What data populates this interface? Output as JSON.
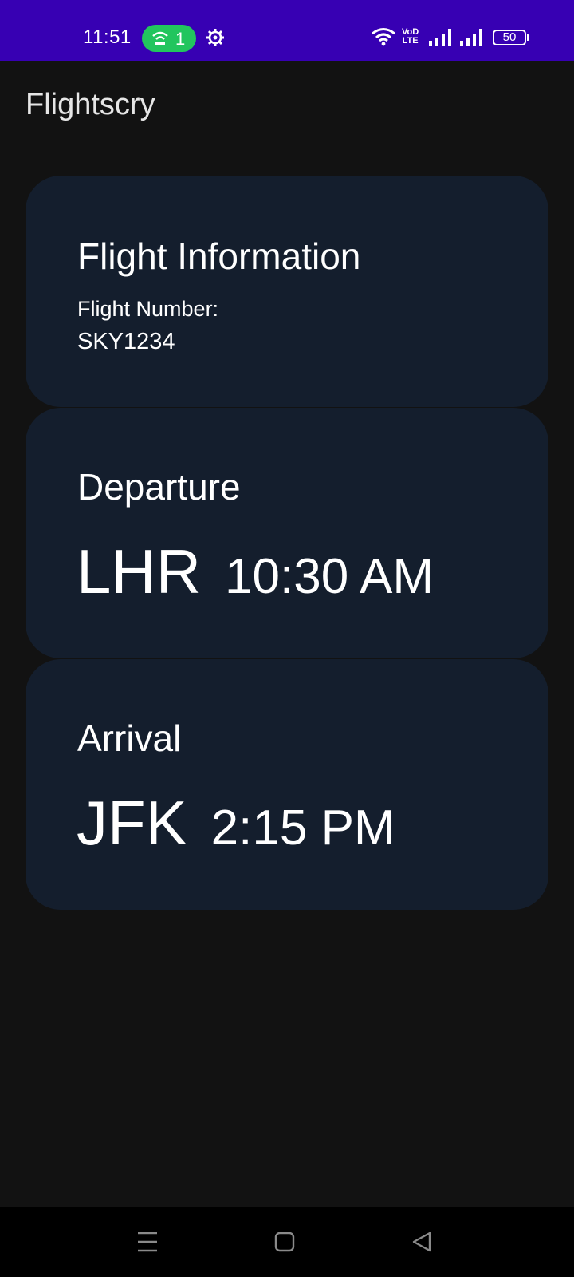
{
  "status_bar": {
    "time": "11:51",
    "hotspot_count": "1",
    "network_label_top": "VoD",
    "network_label_bottom": "LTE",
    "battery_level": "50",
    "color": "#3700b3",
    "hotspot_color": "#22c55e",
    "icons": [
      "hotspot-icon",
      "settings-icon",
      "wifi-icon",
      "signal-icon",
      "signal-icon",
      "battery-icon"
    ]
  },
  "app": {
    "title": "Flightscry"
  },
  "flight_info": {
    "heading": "Flight Information",
    "number_label": "Flight Number:",
    "number_value": "SKY1234"
  },
  "departure": {
    "heading": "Departure",
    "airport": "LHR",
    "time": "10:30 AM"
  },
  "arrival": {
    "heading": "Arrival",
    "airport": "JFK",
    "time": "2:15 PM"
  },
  "nav_bar": {
    "icons": [
      "menu-icon",
      "home-icon",
      "back-icon"
    ]
  },
  "colors": {
    "background": "#121212",
    "card": "#141e2d",
    "text": "#ffffff"
  }
}
